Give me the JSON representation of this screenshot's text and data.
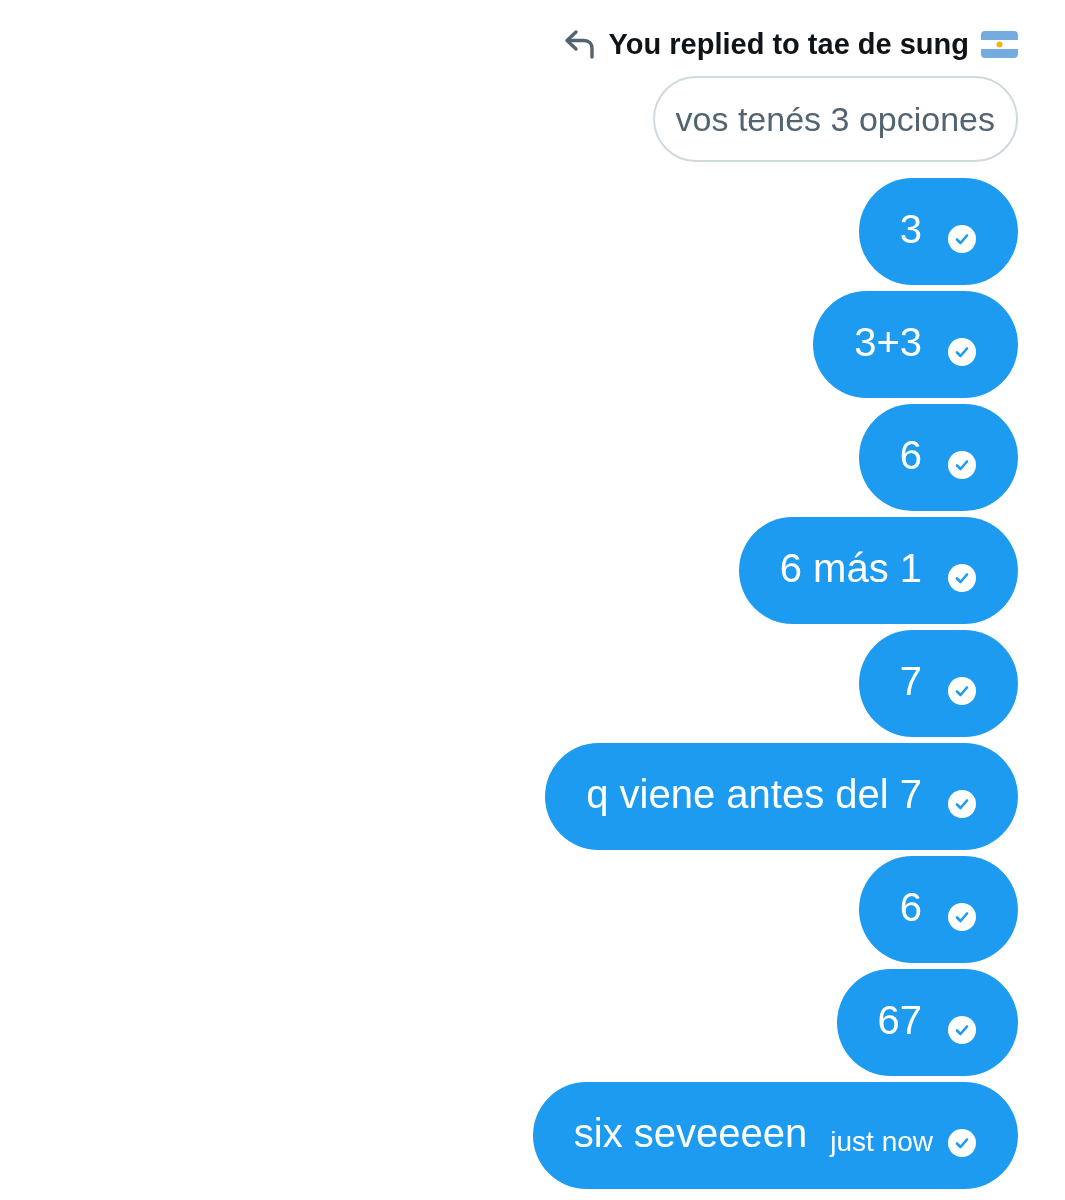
{
  "reply_header": {
    "text": "You replied to tae de sung"
  },
  "quoted_message": {
    "text": "vos tenés 3 opciones"
  },
  "messages": [
    {
      "text": "3",
      "sent": true
    },
    {
      "text": "3+3",
      "sent": true
    },
    {
      "text": "6",
      "sent": true
    },
    {
      "text": "6 más 1",
      "sent": true
    },
    {
      "text": "7",
      "sent": true
    },
    {
      "text": "q viene antes del 7",
      "sent": true
    },
    {
      "text": "6",
      "sent": true
    },
    {
      "text": "67",
      "sent": true
    },
    {
      "text": "six seveeeen",
      "time": "just now",
      "sent": true
    }
  ]
}
